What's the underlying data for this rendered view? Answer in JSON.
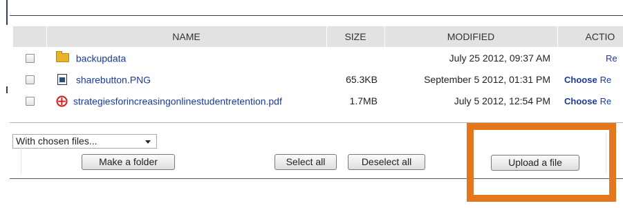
{
  "table": {
    "headers": {
      "name": "NAME",
      "size": "SIZE",
      "modified": "MODIFIED",
      "actions": "ACTIO"
    },
    "rows": [
      {
        "icon": "folder-icon",
        "name": "backupdata",
        "size": "",
        "modified": "July 25 2012, 09:37 AM",
        "choose": "",
        "rename": "Re"
      },
      {
        "icon": "image-file-icon",
        "name": "sharebutton.PNG",
        "size": "65.3KB",
        "modified": "September 5 2012, 01:31 PM",
        "choose": "Choose",
        "rename": "Re"
      },
      {
        "icon": "pdf-icon",
        "name": "strategiesforincreasingonlinestudentretention.pdf",
        "size": "1.7MB",
        "modified": "July 5 2012, 12:54 PM",
        "choose": "Choose",
        "rename": "Re"
      }
    ]
  },
  "controls": {
    "chosen_files_select": "With chosen files...",
    "make_folder": "Make a folder",
    "select_all": "Select all",
    "deselect_all": "Deselect all",
    "upload_file": "Upload a file"
  },
  "highlight": {
    "color": "#e4761b"
  }
}
